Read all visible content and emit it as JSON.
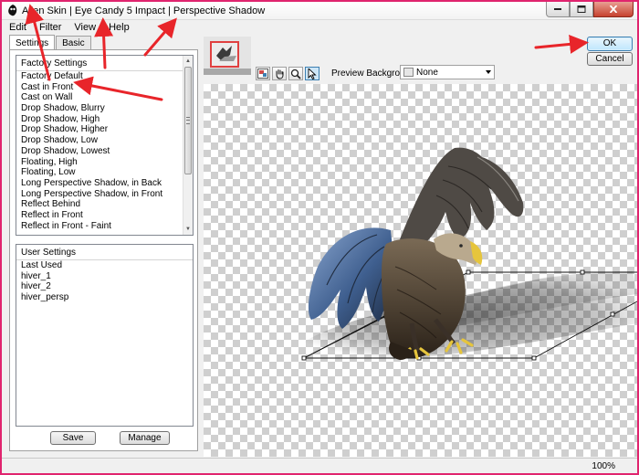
{
  "window": {
    "title": "Alien Skin | Eye Candy 5 Impact | Perspective Shadow"
  },
  "menu": [
    "Edit",
    "Filter",
    "View",
    "Help"
  ],
  "tabs": [
    "Settings",
    "Basic"
  ],
  "factory": {
    "header": "Factory Settings",
    "items": [
      "Factory Default",
      "Cast in Front",
      "Cast on Wall",
      "Drop Shadow, Blurry",
      "Drop Shadow, High",
      "Drop Shadow, Higher",
      "Drop Shadow, Low",
      "Drop Shadow, Lowest",
      "Floating, High",
      "Floating, Low",
      "Long Perspective Shadow, in Back",
      "Long Perspective Shadow, in Front",
      "Reflect Behind",
      "Reflect in Front",
      "Reflect in Front - Faint"
    ]
  },
  "user": {
    "header": "User Settings",
    "items": [
      "Last Used",
      "hiver_1",
      "hiver_2",
      "hiver_persp"
    ]
  },
  "buttons": {
    "save": "Save",
    "manage": "Manage",
    "ok": "OK",
    "cancel": "Cancel"
  },
  "preview": {
    "label": "Preview Background:",
    "value": "None"
  },
  "status": {
    "zoom": "100%"
  },
  "colors": {
    "annotation": "#e8252a",
    "window_border": "#e0246e",
    "ok_border": "#3c7fb1"
  },
  "icons": [
    "app-icon",
    "minimize-icon",
    "maximize-icon",
    "close-icon",
    "navigator-icon",
    "hand-icon",
    "zoom-icon",
    "pointer-icon"
  ]
}
